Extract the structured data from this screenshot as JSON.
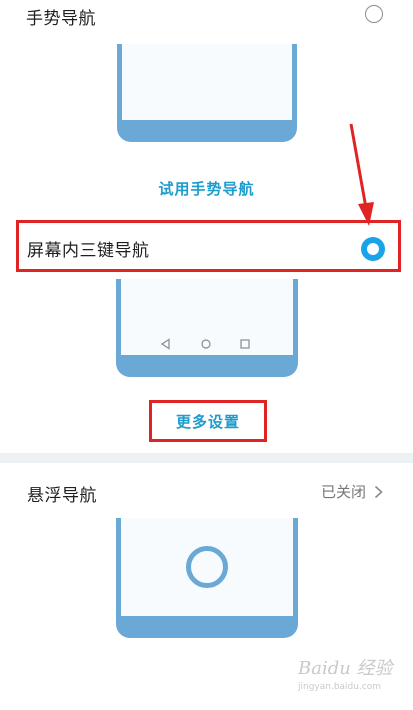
{
  "gesture_nav": {
    "title": "手势导航",
    "try_label": "试用手势导航"
  },
  "three_key_nav": {
    "title": "屏幕内三键导航",
    "more_settings_label": "更多设置"
  },
  "floating_nav": {
    "title": "悬浮导航",
    "status": "已关闭"
  },
  "watermark": {
    "brand": "Baidu 经验",
    "url": "jingyan.baidu.com"
  },
  "colors": {
    "accent": "#1aa3e8",
    "link": "#1e9ccc",
    "phone_frame": "#6aa8d6",
    "annotation_red": "#e02424"
  }
}
